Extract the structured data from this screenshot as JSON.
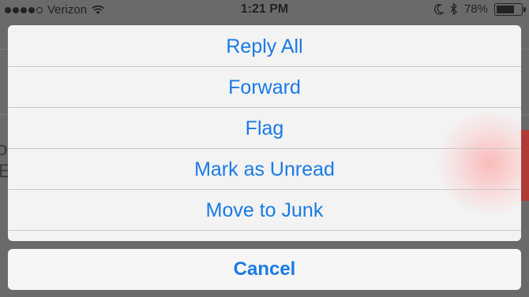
{
  "status_bar": {
    "carrier": "Verizon",
    "time": "1:21 PM",
    "battery_percent": "78%",
    "battery_level": 0.78,
    "signal_icons": [
      "signal-dots-icon",
      "wifi-icon"
    ],
    "right_icons": [
      "moon-icon",
      "bluetooth-icon",
      "battery-icon"
    ]
  },
  "action_sheet": {
    "items": [
      {
        "label": "Reply All"
      },
      {
        "label": "Forward"
      },
      {
        "label": "Flag"
      },
      {
        "label": "Mark as Unread"
      },
      {
        "label": "Move to Junk"
      }
    ],
    "cancel_label": "Cancel",
    "accent_color": "#1a7ae6"
  }
}
